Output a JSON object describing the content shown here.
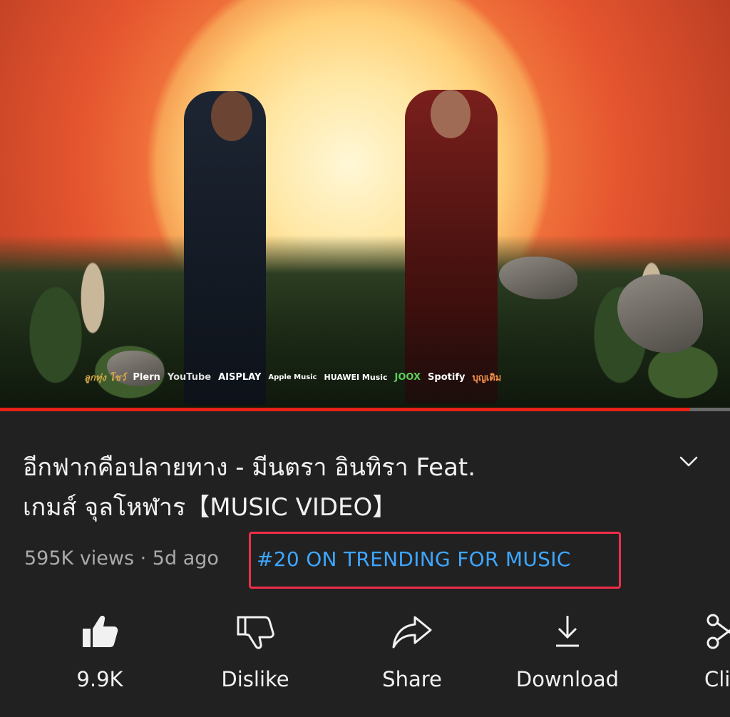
{
  "video": {
    "credits": [
      "ลูกทุ่ง โชว์",
      "Plern",
      "YouTube",
      "AISPLAY",
      "Apple Music",
      "HUAWEI Music",
      "JOOX",
      "Spotify",
      "บุญเติม"
    ],
    "progress_fraction": 0.945,
    "accent_color": "#e62117"
  },
  "title": {
    "line1": "อีกฟากคือปลายทาง - มีนตรา อินทิรา Feat.",
    "line2": "เกมส์ จุลโหฬาร【MUSIC VIDEO】"
  },
  "meta": {
    "views_and_age": "595K views · 5d ago",
    "trending": "#20 ON TRENDING FOR MUSIC"
  },
  "actions": {
    "like": "9.9K",
    "dislike": "Dislike",
    "share": "Share",
    "download": "Download",
    "clip": "Cli"
  },
  "icons": {
    "expand": "chevron-down-icon",
    "like": "thumbs-up-icon",
    "dislike": "thumbs-down-icon",
    "share": "share-arrow-icon",
    "download": "download-icon",
    "clip": "scissors-icon"
  },
  "colors": {
    "background": "#212121",
    "link": "#3ea6ff",
    "highlight_box": "#f02e4a"
  }
}
